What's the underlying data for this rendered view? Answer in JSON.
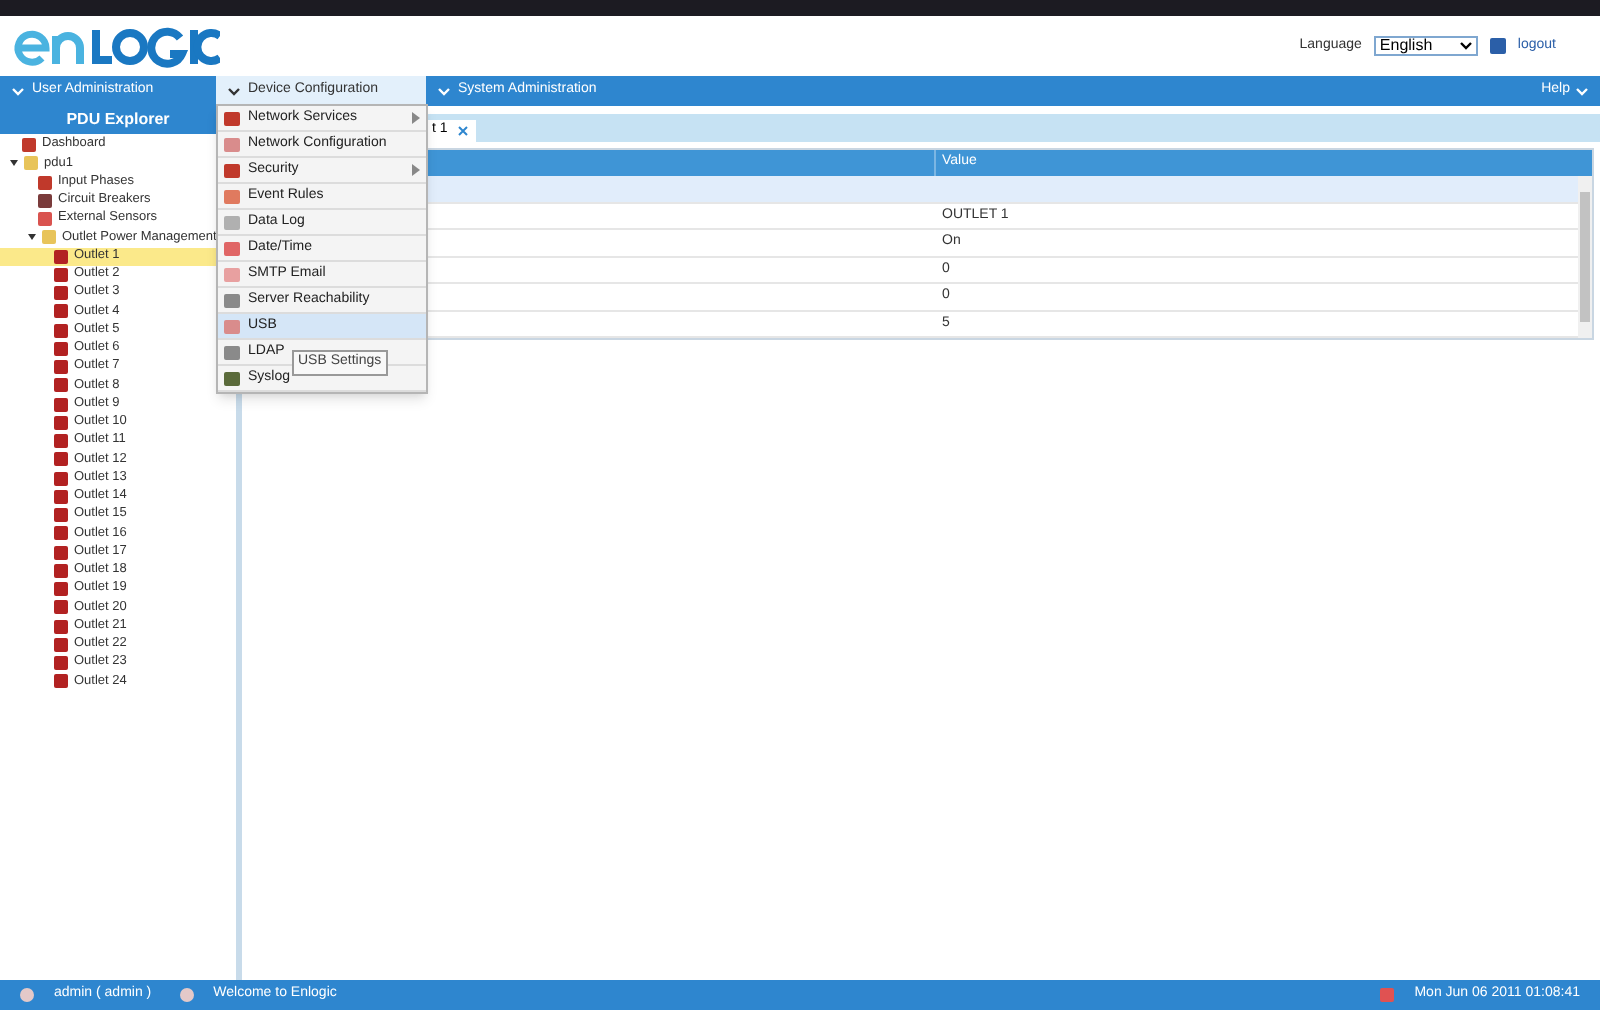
{
  "header": {
    "language_label": "Language",
    "language_value": "English",
    "logout": "logout"
  },
  "nav": {
    "items": [
      {
        "label": "User Administration",
        "selected": false
      },
      {
        "label": "Device Configuration",
        "selected": true
      },
      {
        "label": "System Administration",
        "selected": false
      }
    ],
    "help": "Help"
  },
  "sidebar": {
    "title": "PDU Explorer",
    "tree": [
      {
        "label": "Dashboard",
        "selected": false
      },
      {
        "label": "pdu1",
        "expanded": true,
        "selected": false,
        "children": [
          {
            "label": "Input Phases",
            "selected": false
          },
          {
            "label": "Circuit Breakers",
            "selected": false
          },
          {
            "label": "External Sensors",
            "selected": false
          },
          {
            "label": "Outlet Power Management",
            "expanded": true,
            "selected": false,
            "children": [
              {
                "label": "Outlet 1",
                "selected": true
              },
              {
                "label": "Outlet 2",
                "selected": false
              },
              {
                "label": "Outlet 3",
                "selected": false
              },
              {
                "label": "Outlet 4",
                "selected": false
              },
              {
                "label": "Outlet 5",
                "selected": false
              },
              {
                "label": "Outlet 6",
                "selected": false
              },
              {
                "label": "Outlet 7",
                "selected": false
              },
              {
                "label": "Outlet 8",
                "selected": false
              },
              {
                "label": "Outlet 9",
                "selected": false
              },
              {
                "label": "Outlet 10",
                "selected": false
              },
              {
                "label": "Outlet 11",
                "selected": false
              },
              {
                "label": "Outlet 12",
                "selected": false
              },
              {
                "label": "Outlet 13",
                "selected": false
              },
              {
                "label": "Outlet 14",
                "selected": false
              },
              {
                "label": "Outlet 15",
                "selected": false
              },
              {
                "label": "Outlet 16",
                "selected": false
              },
              {
                "label": "Outlet 17",
                "selected": false
              },
              {
                "label": "Outlet 18",
                "selected": false
              },
              {
                "label": "Outlet 19",
                "selected": false
              },
              {
                "label": "Outlet 20",
                "selected": false
              },
              {
                "label": "Outlet 21",
                "selected": false
              },
              {
                "label": "Outlet 22",
                "selected": false
              },
              {
                "label": "Outlet 23",
                "selected": false
              },
              {
                "label": "Outlet 24",
                "selected": false
              }
            ]
          }
        ]
      }
    ]
  },
  "tabs": [
    {
      "label": "t 1",
      "selected": true
    }
  ],
  "table": {
    "columns": [
      "",
      "Value"
    ],
    "rows": [
      {
        "group": true,
        "value": ""
      },
      {
        "group": false,
        "value": "OUTLET 1"
      },
      {
        "group": false,
        "value": "On"
      },
      {
        "group": false,
        "value": "0"
      },
      {
        "group": false,
        "value": "0"
      },
      {
        "group": false,
        "value": "5"
      }
    ]
  },
  "menu": {
    "items": [
      {
        "label": "Network Services",
        "submenu": true,
        "selected": false
      },
      {
        "label": "Network Configuration",
        "submenu": false,
        "selected": false
      },
      {
        "label": "Security",
        "submenu": true,
        "selected": false
      },
      {
        "label": "Event Rules",
        "submenu": false,
        "selected": false
      },
      {
        "label": "Data Log",
        "submenu": false,
        "selected": false
      },
      {
        "label": "Date/Time",
        "submenu": false,
        "selected": false
      },
      {
        "label": "SMTP Email",
        "submenu": false,
        "selected": false
      },
      {
        "label": "Server Reachability",
        "submenu": false,
        "selected": false
      },
      {
        "label": "USB",
        "submenu": false,
        "selected": true
      },
      {
        "label": "LDAP",
        "submenu": false,
        "selected": false
      },
      {
        "label": "Syslog",
        "submenu": false,
        "selected": false
      }
    ],
    "tooltip": "USB Settings"
  },
  "status_bar": {
    "user": "admin ( admin )",
    "welcome": "Welcome to Enlogic",
    "datetime": "Mon Jun 06 2011 01:08:41"
  }
}
